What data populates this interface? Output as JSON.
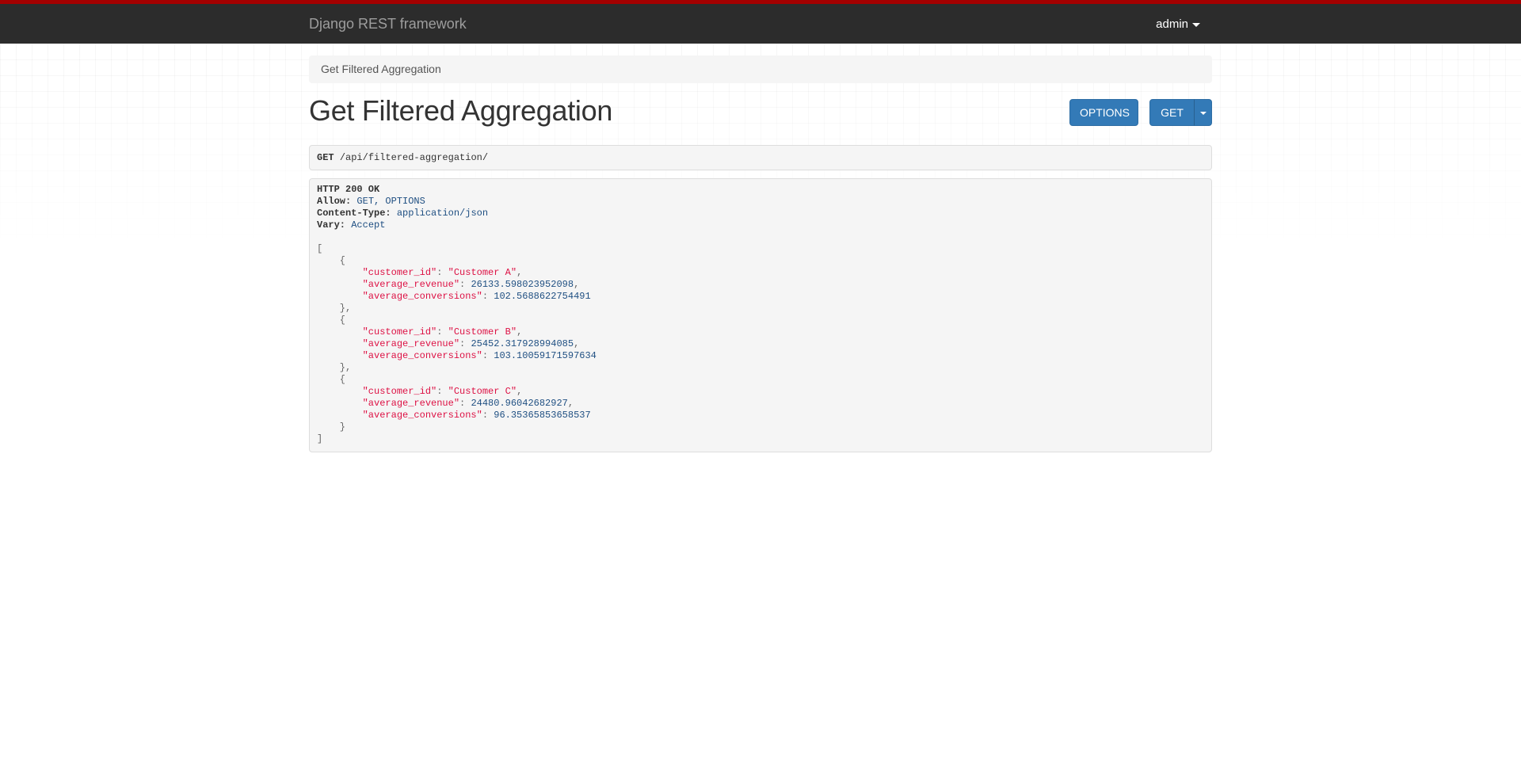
{
  "navbar": {
    "brand": "Django REST framework",
    "user": "admin",
    "top_border_color": "#a30000",
    "background_color": "#2c2c2c"
  },
  "breadcrumb": {
    "items": [
      "Get Filtered Aggregation"
    ]
  },
  "page": {
    "title": "Get Filtered Aggregation"
  },
  "buttons": {
    "options_label": "OPTIONS",
    "get_label": "GET",
    "color": "#337ab7"
  },
  "request": {
    "method": "GET",
    "path": "/api/filtered-aggregation/"
  },
  "response": {
    "status": "HTTP 200 OK",
    "headers": [
      {
        "name": "Allow:",
        "value": "GET, OPTIONS"
      },
      {
        "name": "Content-Type:",
        "value": "application/json"
      },
      {
        "name": "Vary:",
        "value": "Accept"
      }
    ],
    "body": [
      {
        "customer_id": "\"Customer A\"",
        "average_revenue": "26133.598023952098",
        "average_conversions": "102.5688622754491"
      },
      {
        "customer_id": "\"Customer B\"",
        "average_revenue": "25452.317928994085",
        "average_conversions": "103.10059171597634"
      },
      {
        "customer_id": "\"Customer C\"",
        "average_revenue": "24480.96042682927",
        "average_conversions": "96.35365853658537"
      }
    ],
    "keys": {
      "customer_id": "\"customer_id\"",
      "average_revenue": "\"average_revenue\"",
      "average_conversions": "\"average_conversions\""
    }
  }
}
